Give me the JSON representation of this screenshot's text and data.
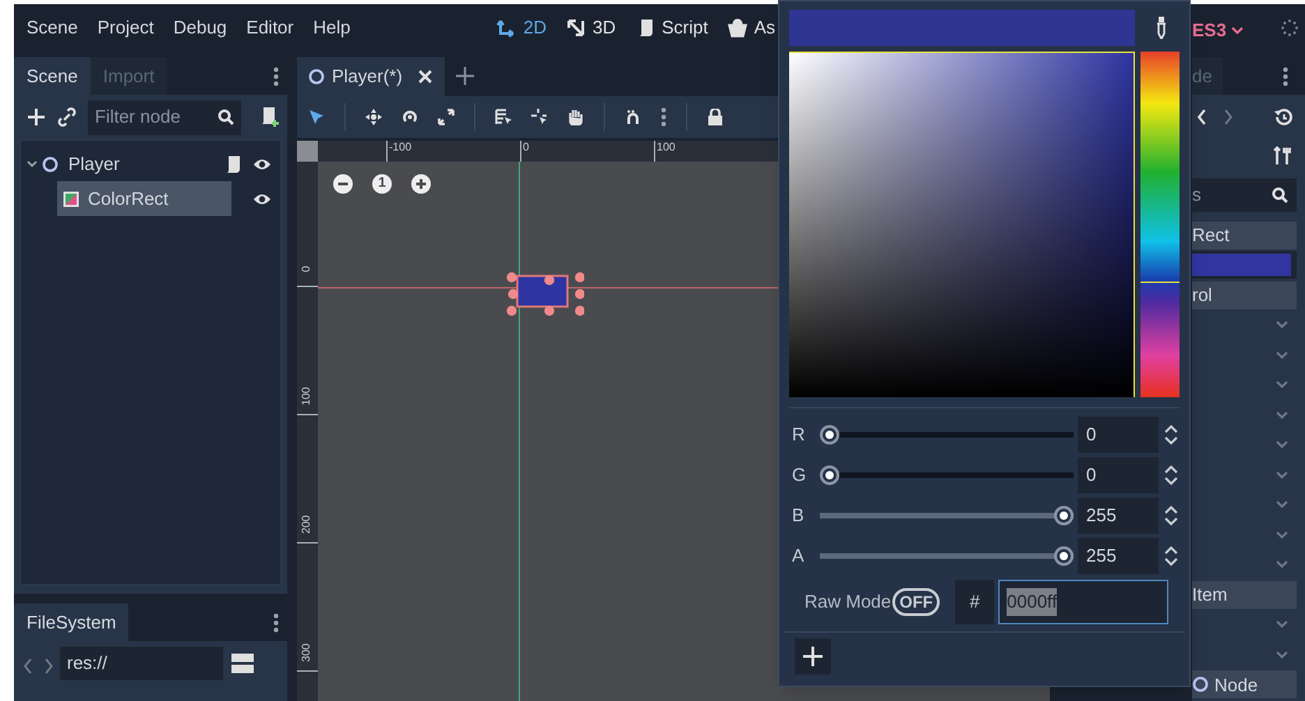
{
  "menu": [
    {
      "label": "Scene"
    },
    {
      "label": "Project"
    },
    {
      "label": "Debug"
    },
    {
      "label": "Editor"
    },
    {
      "label": "Help"
    }
  ],
  "main_screens": [
    {
      "label": "2D",
      "selected": true
    },
    {
      "label": "3D",
      "selected": false
    },
    {
      "label": "Script",
      "selected": false
    },
    {
      "label": "As",
      "selected": false
    }
  ],
  "scene_dock": {
    "tabs": [
      {
        "label": "Scene",
        "selected": true
      },
      {
        "label": "Import",
        "selected": false
      }
    ],
    "filter": {
      "placeholder": "Filter node"
    },
    "tree": [
      {
        "label": "Player",
        "expanded": true,
        "selected": false,
        "children": [
          {
            "label": "ColorRect",
            "selected": true
          }
        ]
      }
    ]
  },
  "filesystem_dock": {
    "tabs": [
      {
        "label": "FileSystem",
        "selected": true
      }
    ],
    "path": "res://"
  },
  "editor_tabs": [
    {
      "label": "Player(*)",
      "selected": true
    }
  ],
  "viewport": {
    "zoom_reset": "1",
    "h_ruler": [
      "-100",
      "0",
      "100"
    ],
    "v_ruler": [
      "0",
      "100",
      "200",
      "300"
    ]
  },
  "right_dock": {
    "renderer": "ES3",
    "tab": "de",
    "search": "s",
    "rows": [
      {
        "kind": "header",
        "label": "Rect"
      },
      {
        "kind": "color"
      },
      {
        "kind": "header",
        "label": "rol"
      },
      {
        "kind": "chevron"
      },
      {
        "kind": "chevron"
      },
      {
        "kind": "chevron"
      },
      {
        "kind": "chevron"
      },
      {
        "kind": "chevron"
      },
      {
        "kind": "chevron"
      },
      {
        "kind": "chevron"
      },
      {
        "kind": "chevron"
      },
      {
        "kind": "chevron"
      },
      {
        "kind": "header",
        "label": "Item"
      },
      {
        "kind": "chevron"
      },
      {
        "kind": "chevron"
      },
      {
        "kind": "node",
        "label": "Node"
      }
    ]
  },
  "color_picker": {
    "sliders": [
      {
        "label": "R",
        "value": "0"
      },
      {
        "label": "G",
        "value": "0"
      },
      {
        "label": "B",
        "value": "255"
      },
      {
        "label": "A",
        "value": "255"
      }
    ],
    "raw_mode": {
      "label": "Raw Mode",
      "on": false,
      "state_text": "OFF"
    },
    "hash": "#",
    "hex": "0000ff"
  }
}
